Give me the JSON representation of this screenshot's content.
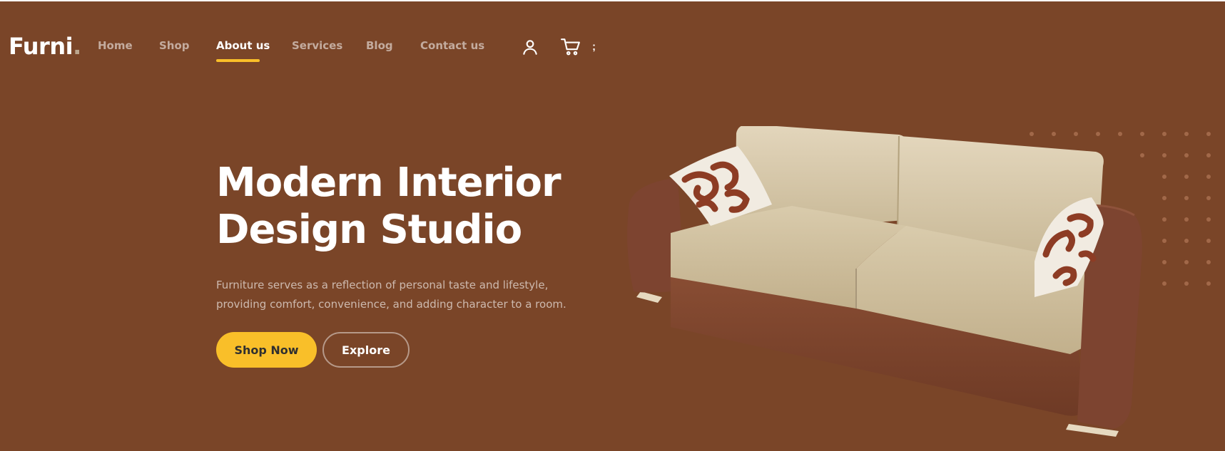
{
  "brand": {
    "name": "Furni",
    "dot": "."
  },
  "nav": {
    "items": [
      {
        "label": "Home"
      },
      {
        "label": "Shop"
      },
      {
        "label": "About us"
      },
      {
        "label": "Services"
      },
      {
        "label": "Blog"
      },
      {
        "label": "Contact us"
      }
    ],
    "active_index": 2,
    "icons": [
      "user-icon",
      "cart-icon",
      "more-icon"
    ],
    "more_glyph": ";"
  },
  "hero": {
    "title_line1": "Modern Interior",
    "title_line2": "Design Studio",
    "desc_line1": "Furniture serves as a reflection of personal taste and lifestyle,",
    "desc_line2": "providing comfort, convenience, and adding character to a room.",
    "primary_button": "Shop Now",
    "secondary_button": "Explore"
  },
  "colors": {
    "background": "#7a4528",
    "accent": "#f9bf29",
    "text": "#ffffff",
    "muted_text": "#c9aa93"
  }
}
